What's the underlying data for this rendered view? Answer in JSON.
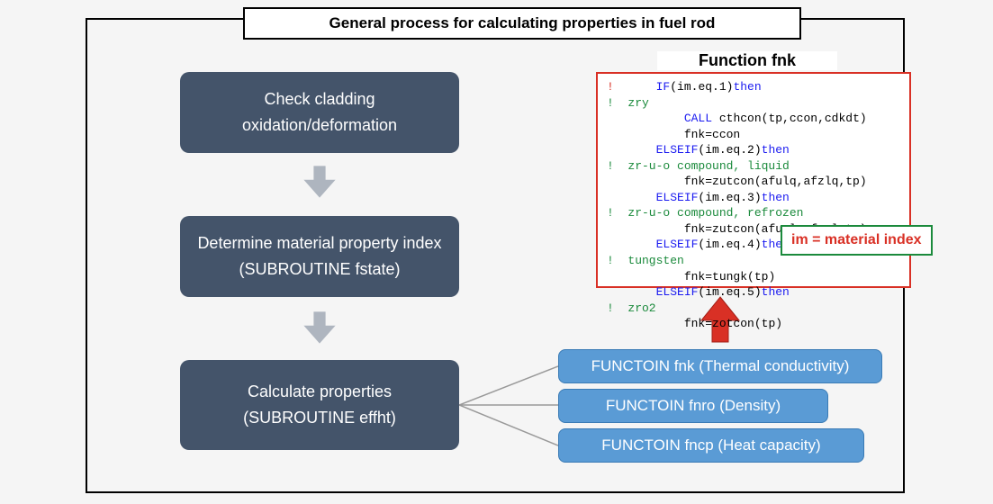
{
  "title": "General process for calculating properties in fuel rod",
  "steps": {
    "s1_l1": "Check cladding",
    "s1_l2": "oxidation/deformation",
    "s2_l1": "Determine material property index",
    "s2_l2": "(SUBROUTINE fstate)",
    "s3_l1": "Calculate properties",
    "s3_l2": "(SUBROUTINE effht)"
  },
  "functions": {
    "fnk": "FUNCTOIN fnk (Thermal conductivity)",
    "fnro": "FUNCTOIN fnro (Density)",
    "fncp": "FUNCTOIN fncp (Heat capacity)"
  },
  "code_title": "Function fnk",
  "mat_index_label": "im = material index",
  "code": {
    "if1": "IF",
    "cond1": "(im.eq.1)",
    "then": "then",
    "c_zry": "!  zry",
    "call": "CALL",
    "call_args": " cthcon(tp,ccon,cdkdt)",
    "assign1": "fnk=ccon",
    "elseif": "ELSEIF",
    "cond2": "(im.eq.2)",
    "c_liq": "!  zr-u-o compound, liquid",
    "assign2": "fnk=zutcon(afulq,afzlq,tp)",
    "cond3": "(im.eq.3)",
    "c_ref": "!  zr-u-o compound, refrozen",
    "assign3": "fnk=zutcon(afusl,afzsl,tp)",
    "cond4": "(im.eq.4)",
    "c_tung": "!  tungsten",
    "assign4": "fnk=tungk(tp)",
    "cond5": "(im.eq.5)",
    "c_zro2": "!  zro2",
    "assign5": "fnk=zotcon(tp)",
    "excl": "!"
  }
}
